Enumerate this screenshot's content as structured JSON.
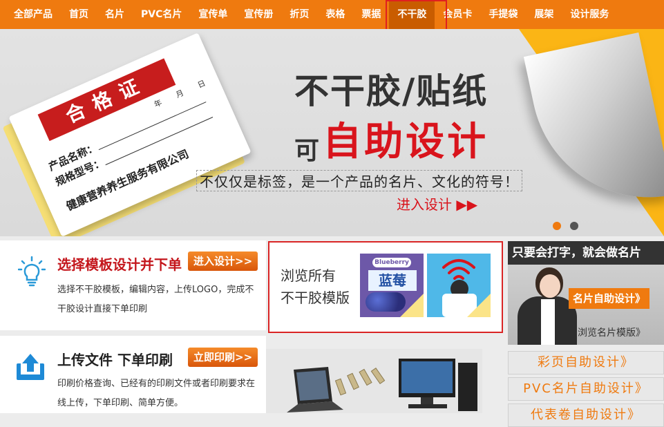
{
  "nav": {
    "items": [
      {
        "label": "全部产品"
      },
      {
        "label": "首页"
      },
      {
        "label": "名片"
      },
      {
        "label": "PVC名片"
      },
      {
        "label": "宣传单"
      },
      {
        "label": "宣传册"
      },
      {
        "label": "折页"
      },
      {
        "label": "表格"
      },
      {
        "label": "票据"
      },
      {
        "label": "不干胶",
        "active": true
      },
      {
        "label": "会员卡"
      },
      {
        "label": "手提袋"
      },
      {
        "label": "展架"
      },
      {
        "label": "设计服务"
      }
    ]
  },
  "banner": {
    "title": "不干胶/贴纸",
    "sub_small": "可",
    "sub_big": "自助设计",
    "slogan": "不仅仅是标签，是一个产品的名片、文化的符号！",
    "enter": "进入设计 ▶▶",
    "certificate": {
      "header": "合格证",
      "line1": "产品名称：",
      "line2": "规格型号：",
      "date": "年 月 日",
      "company": "健康营养养生服务有限公司"
    }
  },
  "select_panel": {
    "title": "选择模板设计并下单",
    "button": "进入设计>>",
    "desc": "选择不干胶模板，编辑内容，上传LOGO，完成不干胶设计直接下单印刷"
  },
  "browse_panel": {
    "line1": "浏览所有",
    "line2": "不干胶模版",
    "thumb1": {
      "label": "Blueberry",
      "title": "蓝莓"
    }
  },
  "upload_panel": {
    "title": "上传文件 下单印刷",
    "button": "立即印刷>>",
    "desc": "印刷价格查询、已经有的印刷文件或者印刷要求在线上传，下单印刷、简单方便。"
  },
  "right": {
    "header": "只要会打字，就会做名片",
    "button": "名片自助设计》",
    "link": "浏览名片模版》",
    "items": [
      {
        "label": "彩页自助设计》"
      },
      {
        "label": "PVC名片自助设计》"
      },
      {
        "label": "代表卷自助设计》"
      }
    ]
  },
  "colors": {
    "nav_bg": "#ef7a0f",
    "accent_red": "#d9141c",
    "peel_yellow": "#fbb515"
  }
}
